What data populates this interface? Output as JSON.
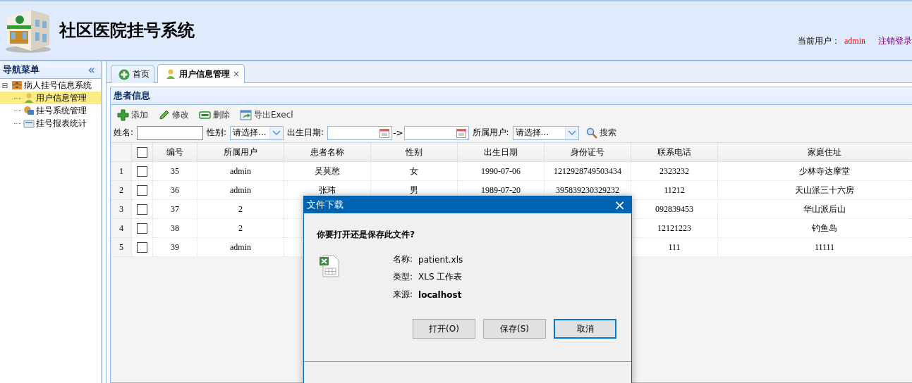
{
  "header": {
    "title": "社区医院挂号系统",
    "user_label": "当前用户：",
    "user_name": "admin",
    "logout": "注销登录"
  },
  "nav": {
    "title": "导航菜单",
    "collapse": "«",
    "tree": [
      {
        "label": "病人挂号信息系统",
        "toggle": "⊟",
        "expanded": true,
        "selected": false,
        "children": [
          {
            "label": "用户信息管理",
            "selected": true
          },
          {
            "label": "挂号系统管理",
            "selected": false
          },
          {
            "label": "挂号报表统计",
            "selected": false
          }
        ]
      }
    ]
  },
  "tabs": [
    {
      "label": "首页",
      "selected": false,
      "closable": false
    },
    {
      "label": "用户信息管理",
      "selected": true,
      "closable": true,
      "close": "×"
    }
  ],
  "panel": {
    "title": "患者信息",
    "toolbar": [
      {
        "label": "添加",
        "kind": "add"
      },
      {
        "label": "修改",
        "kind": "edit"
      },
      {
        "label": "删除",
        "kind": "delete"
      },
      {
        "label": "导出Execl",
        "kind": "export"
      }
    ],
    "search": {
      "name_label": "姓名:",
      "gender_label": "性别:",
      "gender_value": "请选择...",
      "birth_label": "出生日期:",
      "range_sep": "->",
      "owner_label": "所属用户:",
      "owner_value": "请选择...",
      "search_button": "搜索"
    },
    "table": {
      "header_checked": false,
      "columns": [
        "编号",
        "所属用户",
        "患者名称",
        "性别",
        "出生日期",
        "身份证号",
        "联系电话",
        "家庭住址"
      ],
      "rows": [
        {
          "num": "1",
          "checked": false,
          "cells": [
            "35",
            "admin",
            "吴莫愁",
            "女",
            "1990-07-06",
            "1212928749503434",
            "2323232",
            "少林寺达摩堂"
          ]
        },
        {
          "num": "2",
          "checked": false,
          "cells": [
            "36",
            "admin",
            "张玮",
            "男",
            "1989-07-20",
            "395839230329232",
            "11212",
            "天山派三十六房"
          ]
        },
        {
          "num": "3",
          "checked": false,
          "cells": [
            "37",
            "2",
            null,
            null,
            null,
            null,
            "092839453",
            "华山派后山"
          ]
        },
        {
          "num": "4",
          "checked": false,
          "cells": [
            "38",
            "2",
            null,
            null,
            null,
            null,
            "12121223",
            "钓鱼岛"
          ]
        },
        {
          "num": "5",
          "checked": false,
          "cells": [
            "39",
            "admin",
            null,
            null,
            null,
            null,
            "111",
            "11111"
          ]
        }
      ]
    }
  },
  "dialog": {
    "title": "文件下载",
    "close": "×",
    "question": "你要打开还是保存此文件?",
    "info": [
      {
        "label": "名称:",
        "value": "patient.xls",
        "bold": false
      },
      {
        "label": "类型:",
        "value": "XLS 工作表",
        "bold": false
      },
      {
        "label": "来源:",
        "value": "localhost",
        "bold": true
      }
    ],
    "buttons": [
      {
        "label": "打开(O)",
        "focused": false
      },
      {
        "label": "保存(S)",
        "focused": false
      },
      {
        "label": "取消",
        "focused": true
      }
    ]
  }
}
